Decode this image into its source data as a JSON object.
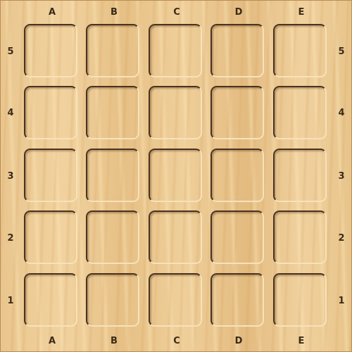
{
  "board": {
    "files": [
      "A",
      "B",
      "C",
      "D",
      "E"
    ],
    "ranks": [
      "5",
      "4",
      "3",
      "2",
      "1"
    ],
    "wood_color": "#e9c68e",
    "groove_color": "#4a3320",
    "label_color": "#3a2a18"
  }
}
